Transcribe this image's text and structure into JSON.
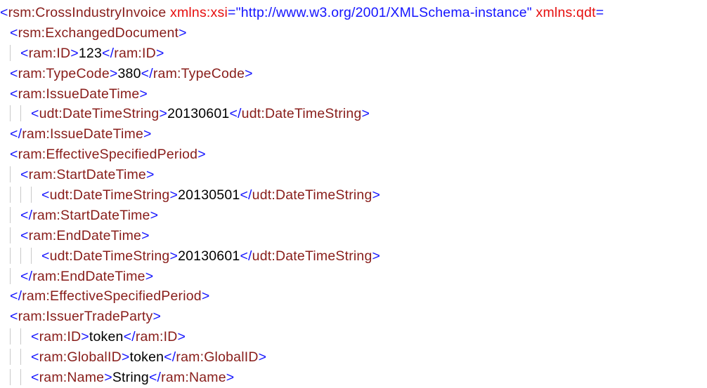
{
  "xml": {
    "root": {
      "tag": "rsm:CrossIndustryInvoice",
      "attr1_name": "xmlns:xsi",
      "attr1_val": "\"http://www.w3.org/2001/XMLSchema-instance\"",
      "attr2_name": "xmlns:qdt",
      "trail": "="
    },
    "exchangedDocument_tag": "rsm:ExchangedDocument",
    "id": {
      "tag": "ram:ID",
      "val": "123"
    },
    "typeCode": {
      "tag": "ram:TypeCode",
      "val": "380"
    },
    "issueDateTime_tag": "ram:IssueDateTime",
    "dts_tag": "udt:DateTimeString",
    "issueDateTime_val": "20130601",
    "effectivePeriod_tag": "ram:EffectiveSpecifiedPeriod",
    "startDateTime_tag": "ram:StartDateTime",
    "startDateTime_val": "20130501",
    "endDateTime_tag": "ram:EndDateTime",
    "endDateTime_val": "20130601",
    "issuerTradeParty_tag": "ram:IssuerTradeParty",
    "issuerId": {
      "tag": "ram:ID",
      "val": "token"
    },
    "globalId": {
      "tag": "ram:GlobalID",
      "val": "token"
    },
    "name": {
      "tag": "ram:Name",
      "val": "String"
    }
  }
}
